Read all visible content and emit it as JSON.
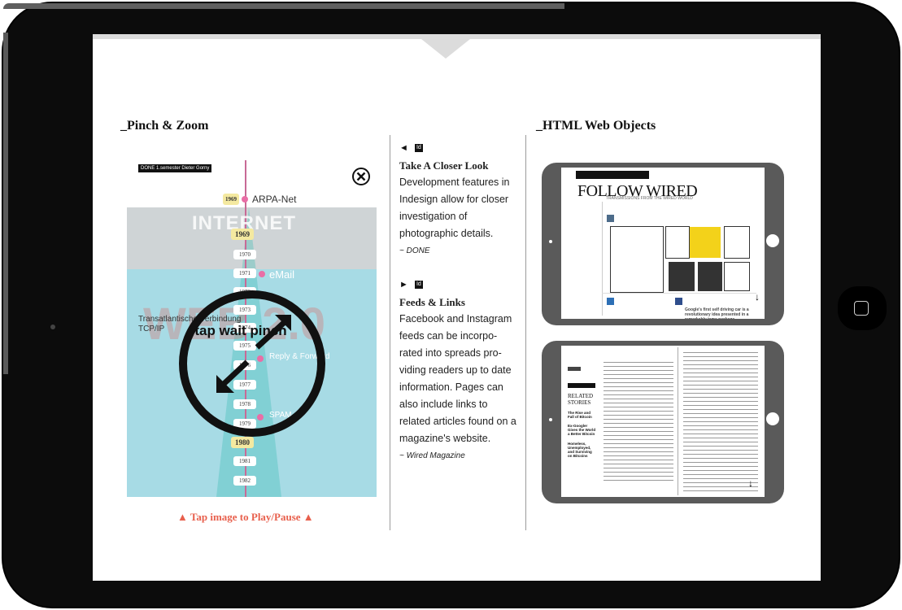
{
  "device": {
    "frame_color": "#0c0c0c"
  },
  "sections": {
    "pinch_title": "_Pinch & Zoom",
    "web_title": "_HTML Web Objects"
  },
  "pinch": {
    "done_tag": "DONE",
    "tag_sub": "1.semester",
    "tag_name": "Dieter Gorny",
    "arpa_year": "1969",
    "arpa_label": "ARPA-Net",
    "internet": "INTERNET",
    "web": "WEB 2.0",
    "years": [
      "1969",
      "1970",
      "1971",
      "1972",
      "1973",
      "1974",
      "1975",
      "1976",
      "1977",
      "1978",
      "1979",
      "1980",
      "1981",
      "1982"
    ],
    "labels": {
      "email": "eMail",
      "transatlantic": "Transatlantische Verbindung",
      "tcpip": "TCP/IP",
      "reply": "Reply & Forward",
      "spam": "SPAM"
    },
    "overlay_text": "tap wait pinch",
    "caption": "▲ Tap image to Play/Pause ▲"
  },
  "middle": {
    "block1": {
      "icons": "◄",
      "id_badge": "Id",
      "heading": "Take A Closer Look",
      "body": "Development features in Indesign allow for closer investigation of photographic details.",
      "source": "~ DONE"
    },
    "block2": {
      "icons": "►",
      "id_badge": "Id",
      "heading": "Feeds & Links",
      "body": "Facebook and Instagram feeds can be incorpo-rated into spreads pro-viding readers up to date information. Pages can also include links to related articles found on a magazine's website.",
      "source": "~ Wired Magazine"
    }
  },
  "tablets": {
    "wired_title": "FOLLOW WIRED",
    "wired_sub": "TRANSMISSIONS FROM THE WIRED WORLD",
    "related": "RELATED STORIES",
    "related_items": [
      "The Rise and Fall of Bitcoin",
      "Ex-Googler Gives the World a Better Bitcoin",
      "Homeless, Unemployed, and Surviving on Bitcoins"
    ],
    "google_note": "Google's first self driving car is a revolutionary idea presented in a remarkably tame package"
  }
}
